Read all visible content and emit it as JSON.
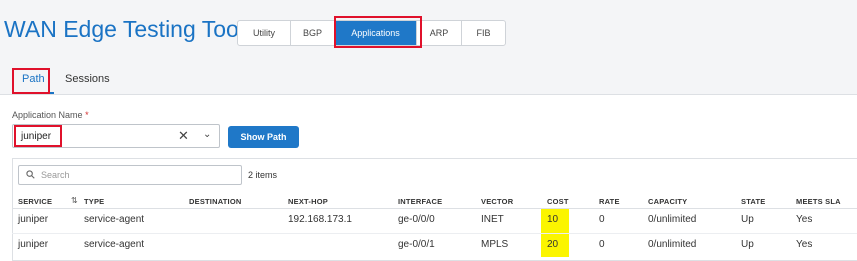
{
  "app": {
    "title": "WAN Edge Testing Tools"
  },
  "nav": {
    "buttons": [
      {
        "label": "Utility"
      },
      {
        "label": "BGP"
      },
      {
        "label": "Applications"
      },
      {
        "label": "ARP"
      },
      {
        "label": "FIB"
      }
    ],
    "active": "Applications"
  },
  "subtabs": [
    {
      "label": "Path"
    },
    {
      "label": "Sessions"
    }
  ],
  "form": {
    "app_name_label": "Application Name",
    "required_mark": "*",
    "app_name_value": "juniper",
    "clear_glyph": "✕",
    "dropdown_glyph": "⌄",
    "show_path_label": "Show Path"
  },
  "table": {
    "search_placeholder": "Search",
    "item_count": "2 items",
    "sort_glyph": "⇅",
    "columns": [
      "SERVICE",
      "TYPE",
      "DESTINATION",
      "NEXT-HOP",
      "INTERFACE",
      "VECTOR",
      "COST",
      "RATE",
      "CAPACITY",
      "STATE",
      "MEETS SLA"
    ],
    "rows": [
      [
        "juniper",
        "service-agent",
        "",
        "192.168.173.1",
        "ge-0/0/0",
        "INET",
        "10",
        "0",
        "0/unlimited",
        "Up",
        "Yes"
      ],
      [
        "juniper",
        "service-agent",
        "",
        "",
        "ge-0/0/1",
        "MPLS",
        "20",
        "0",
        "0/unlimited",
        "Up",
        "Yes"
      ]
    ]
  },
  "colors": {
    "accent": "#1f78c8",
    "highlight_box": "#e0112b",
    "cost_highlight": "#fbf500"
  }
}
